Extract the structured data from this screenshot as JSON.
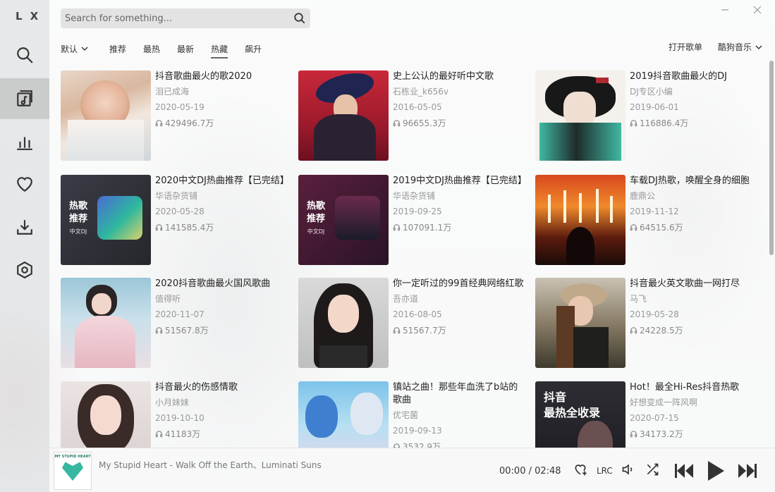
{
  "app": {
    "logo_letters": [
      "L",
      "X"
    ]
  },
  "search": {
    "placeholder": "Search for something..."
  },
  "tabs": {
    "sort_label": "默认",
    "items": [
      {
        "label": "推荐"
      },
      {
        "label": "最热"
      },
      {
        "label": "最新"
      },
      {
        "label": "热藏",
        "active": true
      },
      {
        "label": "飙升"
      }
    ]
  },
  "header_right": {
    "open_list": "打开歌单",
    "source": "酷狗音乐"
  },
  "playlists": [
    {
      "title": "抖音歌曲最火的歌2020",
      "author": "泪已成海",
      "date": "2020-05-19",
      "plays": "429496.7万"
    },
    {
      "title": "史上公认的最好听中文歌",
      "author": "石栋业_k656v",
      "date": "2016-05-05",
      "plays": "96655.3万"
    },
    {
      "title": "2019抖音歌曲最火的DJ",
      "author": "DJ专区小编",
      "date": "2019-06-01",
      "plays": "116886.4万"
    },
    {
      "title": "2020中文DJ热曲推荐【已完结】",
      "author": "华语杂货铺",
      "date": "2020-05-28",
      "plays": "141585.4万",
      "overlay": "热歌\n推荐",
      "overlay_sub": "中文DJ"
    },
    {
      "title": "2019中文DJ热曲推荐【已完结】",
      "author": "华语杂货铺",
      "date": "2019-09-25",
      "plays": "107091.1万",
      "overlay": "热歌\n推荐",
      "overlay_sub": "中文DJ"
    },
    {
      "title": "车载DJ热歌，唤醒全身的细胞",
      "author": "鹿鼎公",
      "date": "2019-11-12",
      "plays": "64515.6万"
    },
    {
      "title": "2020抖音歌曲最火国风歌曲",
      "author": "值得听",
      "date": "2020-11-07",
      "plays": "51567.8万"
    },
    {
      "title": "你一定听过的99首经典网络红歌",
      "author": "吾亦道",
      "date": "2016-08-05",
      "plays": "51567.7万"
    },
    {
      "title": "抖音最火英文歌曲一网打尽",
      "author": "马飞",
      "date": "2019-05-28",
      "plays": "24228.5万"
    },
    {
      "title": "抖音最火的伤感情歌",
      "author": "小月妹妹",
      "date": "2019-10-10",
      "plays": "41183万"
    },
    {
      "title": "镇站之曲！那些年血洗了b站的歌曲",
      "author": "优宅菌",
      "date": "2019-09-13",
      "plays": "3532.9万"
    },
    {
      "title": "Hot！最全Hi-Res抖音热歌",
      "author": "好想变成一阵风啊",
      "date": "2020-07-15",
      "plays": "34173.2万",
      "overlay": "抖音\n最热全收录"
    }
  ],
  "player": {
    "track": "My Stupid Heart - Walk Off the Earth、Luminati Suns",
    "thumb_text": "MY STUPID HEART",
    "time": "00:00 / 02:48",
    "lrc_label": "LRC"
  },
  "colors": {
    "accent": "#333333"
  }
}
